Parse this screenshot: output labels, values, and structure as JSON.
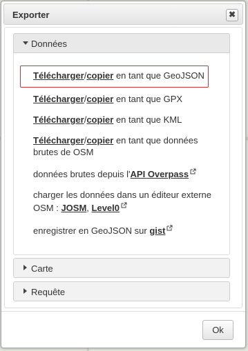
{
  "dialog": {
    "title": "Exporter",
    "close_glyph": "✖",
    "ok_label": "Ok"
  },
  "sections": [
    {
      "label": "Données",
      "expanded": true
    },
    {
      "label": "Carte",
      "expanded": false
    },
    {
      "label": "Requête",
      "expanded": false
    }
  ],
  "export_options": {
    "geojson": {
      "download": "Télécharger",
      "sep": "/",
      "copy": "copier",
      "text": " en tant que GeoJSON"
    },
    "gpx": {
      "download": "Télécharger",
      "sep": "/",
      "copy": "copier",
      "text": " en tant que GPX"
    },
    "kml": {
      "download": "Télécharger",
      "sep": "/",
      "copy": "copier",
      "text": " en tant que KML"
    },
    "raw": {
      "download": "Télécharger",
      "sep": "/",
      "copy": "copier",
      "text": " en tant que données",
      "text_line2": "brutes de OSM"
    },
    "overpass": {
      "prefix": "données brutes depuis l'",
      "link": "API Overpass"
    },
    "editor": {
      "line1": "charger les données dans un éditeur externe",
      "prefix": "OSM : ",
      "link1": "JOSM",
      "sep": ", ",
      "link2": "Level0"
    },
    "gist": {
      "prefix": "enregistrer en GeoJSON sur ",
      "link": "gist"
    }
  },
  "icons": {
    "accordion_expanded": "triangle-down-icon",
    "accordion_collapsed": "triangle-right-icon",
    "external_link": "external-link-icon"
  },
  "colors": {
    "highlight_border": "#c9353d"
  }
}
